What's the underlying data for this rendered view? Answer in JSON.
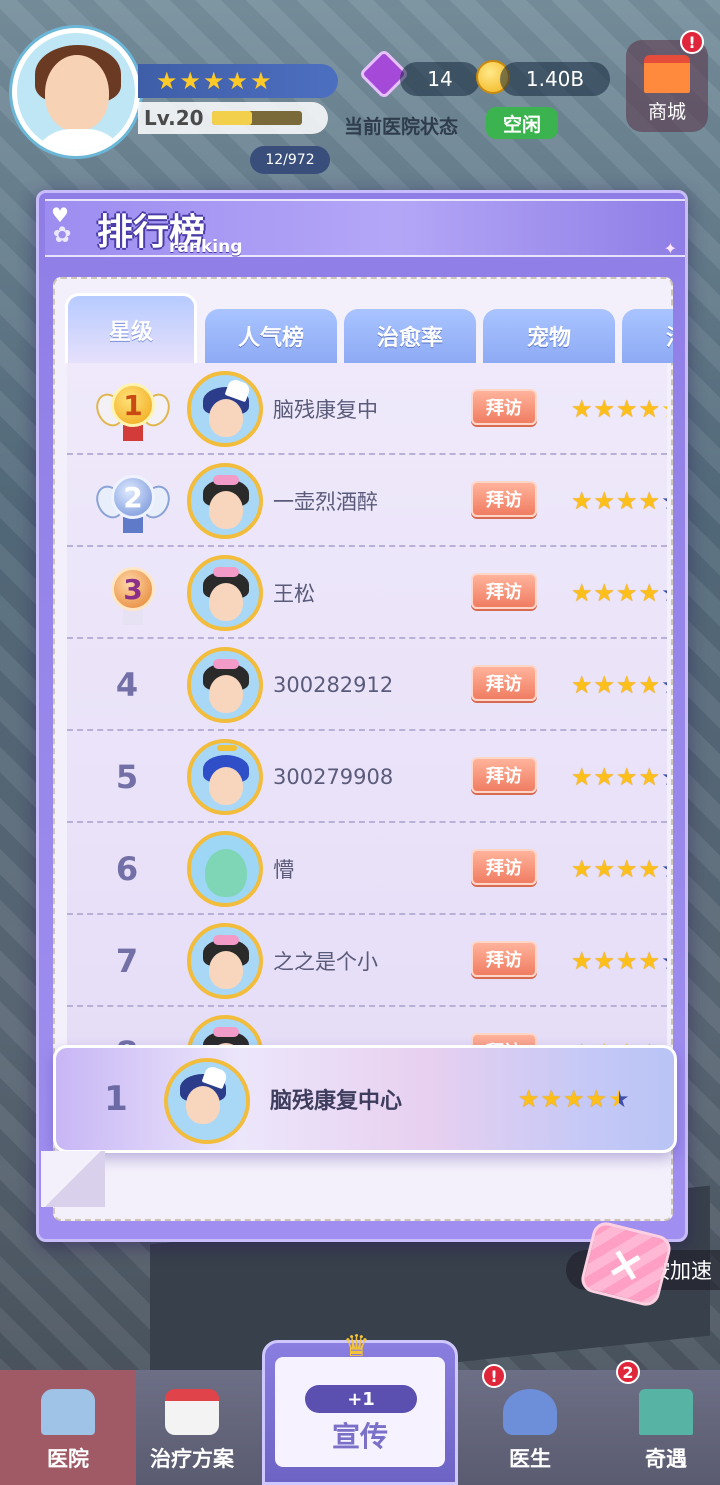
{
  "hud": {
    "level": "Lv.20",
    "level_progress": 0.45,
    "task_progress": "12/972",
    "gems": "14",
    "coins": "1.40B",
    "status_label": "当前医院状态",
    "status_value": "空闲",
    "shop_label": "商城",
    "player_stars": 4.5
  },
  "panel": {
    "title": "排行榜",
    "subtitle": "ranking"
  },
  "tabs": [
    {
      "label": "星级",
      "active": true
    },
    {
      "label": "人气榜"
    },
    {
      "label": "治愈率"
    },
    {
      "label": "宠物"
    },
    {
      "label": "治疗"
    }
  ],
  "ranking": {
    "visit_label": "拜访",
    "rows": [
      {
        "rank": "1",
        "name": "脑残康复中",
        "stars": 4.5,
        "medal": "gold",
        "avatar": "cat"
      },
      {
        "rank": "2",
        "name": "一壶烈酒醉",
        "stars": 4,
        "medal": "silver",
        "avatar": "bow"
      },
      {
        "rank": "3",
        "name": "王松",
        "stars": 4,
        "medal": "bronze",
        "avatar": "bow"
      },
      {
        "rank": "4",
        "name": "300282912",
        "stars": 4,
        "avatar": "bow"
      },
      {
        "rank": "5",
        "name": "300279908",
        "stars": 4,
        "avatar": "blue"
      },
      {
        "rank": "6",
        "name": "懵",
        "stars": 4,
        "avatar": "alien"
      },
      {
        "rank": "7",
        "name": "之之是个小",
        "stars": 4,
        "avatar": "bow"
      },
      {
        "rank": "8",
        "name": "",
        "stars": 4,
        "avatar": "bow"
      }
    ]
  },
  "my_rank": {
    "rank": "1",
    "name": "脑残康复中心",
    "stars": 4.5
  },
  "speed_hint": "长按加速",
  "nav": {
    "hospital": "医院",
    "treatment": "治疗方案",
    "promo": "宣传",
    "promo_bonus": "+1",
    "doctor": "医生",
    "adventure": "奇遇",
    "adventure_badge": "2"
  },
  "icons": {
    "close": "×",
    "star": "★"
  }
}
